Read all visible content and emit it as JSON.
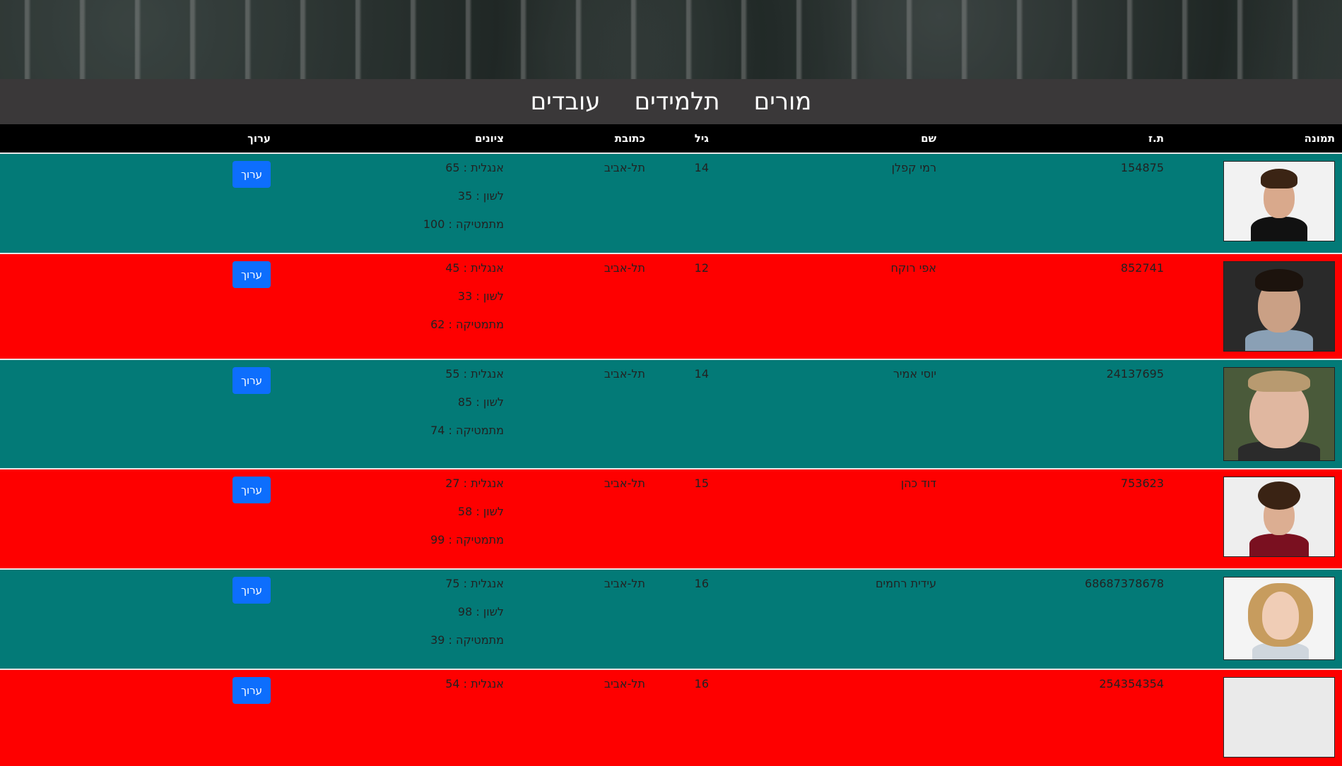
{
  "nav": {
    "links": [
      "מורים",
      "תלמידים",
      "עובדים"
    ]
  },
  "table": {
    "headers": {
      "photo": "תמונה",
      "id": "ת.ז",
      "name": "שם",
      "age": "גיל",
      "address": "כתובת",
      "grades": "ציונים",
      "edit": "ערוך"
    },
    "rows": [
      {
        "id": "154875",
        "name": "רמי קפלן",
        "age": "14",
        "address": "תל-אביב",
        "grades": [
          "אנגלית : 65",
          "לשון : 35",
          "מתמטיקה : 100"
        ],
        "edit": "ערוך",
        "color": "#037a77"
      },
      {
        "id": "852741",
        "name": "אפי רוקח",
        "age": "12",
        "address": "תל-אביב",
        "grades": [
          "אנגלית : 45",
          "לשון : 33",
          "מתמטיקה : 62"
        ],
        "edit": "ערוך",
        "color": "#fe0000"
      },
      {
        "id": "24137695",
        "name": "יוסי אמיר",
        "age": "14",
        "address": "תל-אביב",
        "grades": [
          "אנגלית : 55",
          "לשון : 85",
          "מתמטיקה : 74"
        ],
        "edit": "ערוך",
        "color": "#037a77"
      },
      {
        "id": "753623",
        "name": "דוד כהן",
        "age": "15",
        "address": "תל-אביב",
        "grades": [
          "אנגלית : 27",
          "לשון : 58",
          "מתמטיקה : 99"
        ],
        "edit": "ערוך",
        "color": "#fe0000"
      },
      {
        "id": "68687378678",
        "name": "עידית רחמים",
        "age": "16",
        "address": "תל-אביב",
        "grades": [
          "אנגלית : 75",
          "לשון : 98",
          "מתמטיקה : 39"
        ],
        "edit": "ערוך",
        "color": "#037a77"
      },
      {
        "id": "254354354",
        "name": "",
        "age": "16",
        "address": "תל-אביב",
        "grades": [
          "אנגלית : 54"
        ],
        "edit": "ערוך",
        "color": "#fe0000"
      }
    ]
  }
}
